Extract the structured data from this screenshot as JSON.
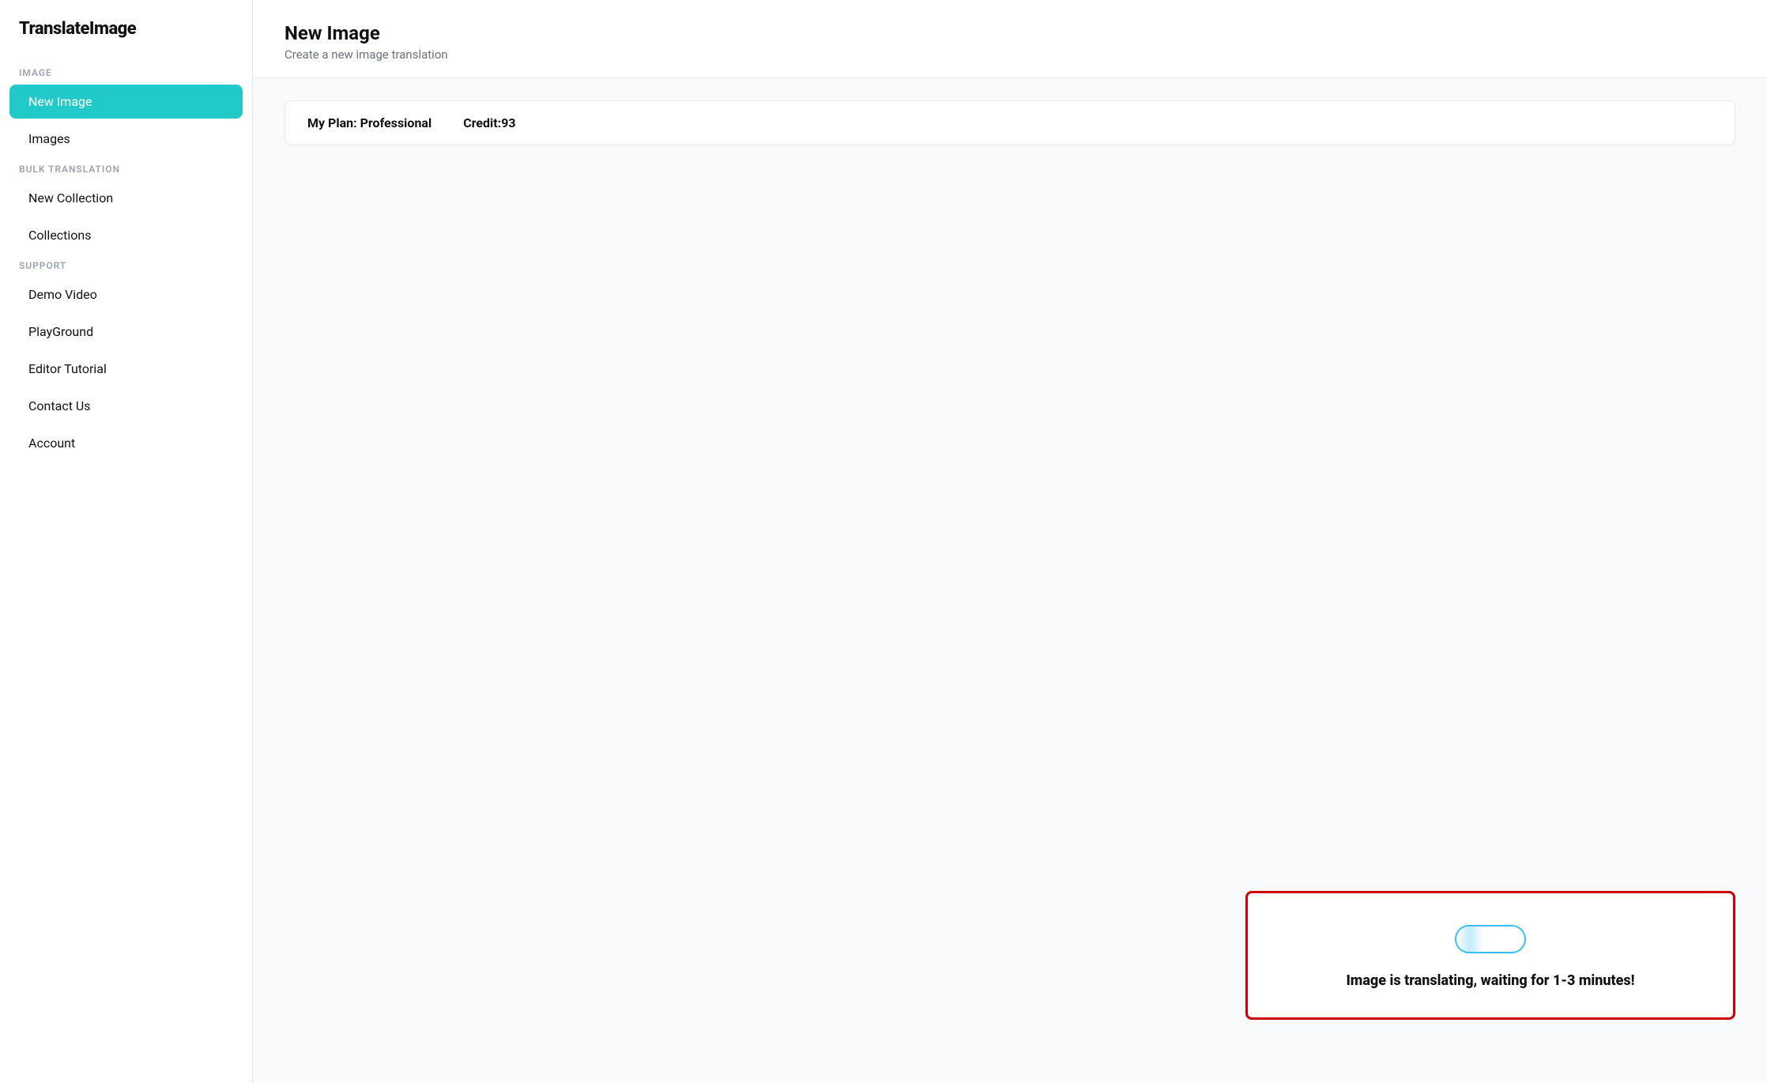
{
  "app": {
    "logo": "TranslateImage"
  },
  "sidebar": {
    "sections": [
      {
        "label": "IMAGE",
        "items": [
          {
            "id": "new-image",
            "text": "New Image",
            "active": true
          },
          {
            "id": "images",
            "text": "Images",
            "active": false
          }
        ]
      },
      {
        "label": "BULK TRANSLATION",
        "items": [
          {
            "id": "new-collection",
            "text": "New Collection",
            "active": false
          },
          {
            "id": "collections",
            "text": "Collections",
            "active": false
          }
        ]
      },
      {
        "label": "SUPPORT",
        "items": [
          {
            "id": "demo-video",
            "text": "Demo Video",
            "active": false
          },
          {
            "id": "playground",
            "text": "PlayGround",
            "active": false
          },
          {
            "id": "editor-tutorial",
            "text": "Editor Tutorial",
            "active": false
          },
          {
            "id": "contact-us",
            "text": "Contact Us",
            "active": false
          },
          {
            "id": "account",
            "text": "Account",
            "active": false
          }
        ]
      }
    ]
  },
  "main": {
    "header": {
      "title": "New Image",
      "subtitle": "Create a new image translation"
    },
    "plan_bar": {
      "plan_text": "My Plan: Professional",
      "credit_text": "Credit:93"
    },
    "translation_status": {
      "message": "Image is translating, waiting for 1-3 minutes!"
    }
  }
}
